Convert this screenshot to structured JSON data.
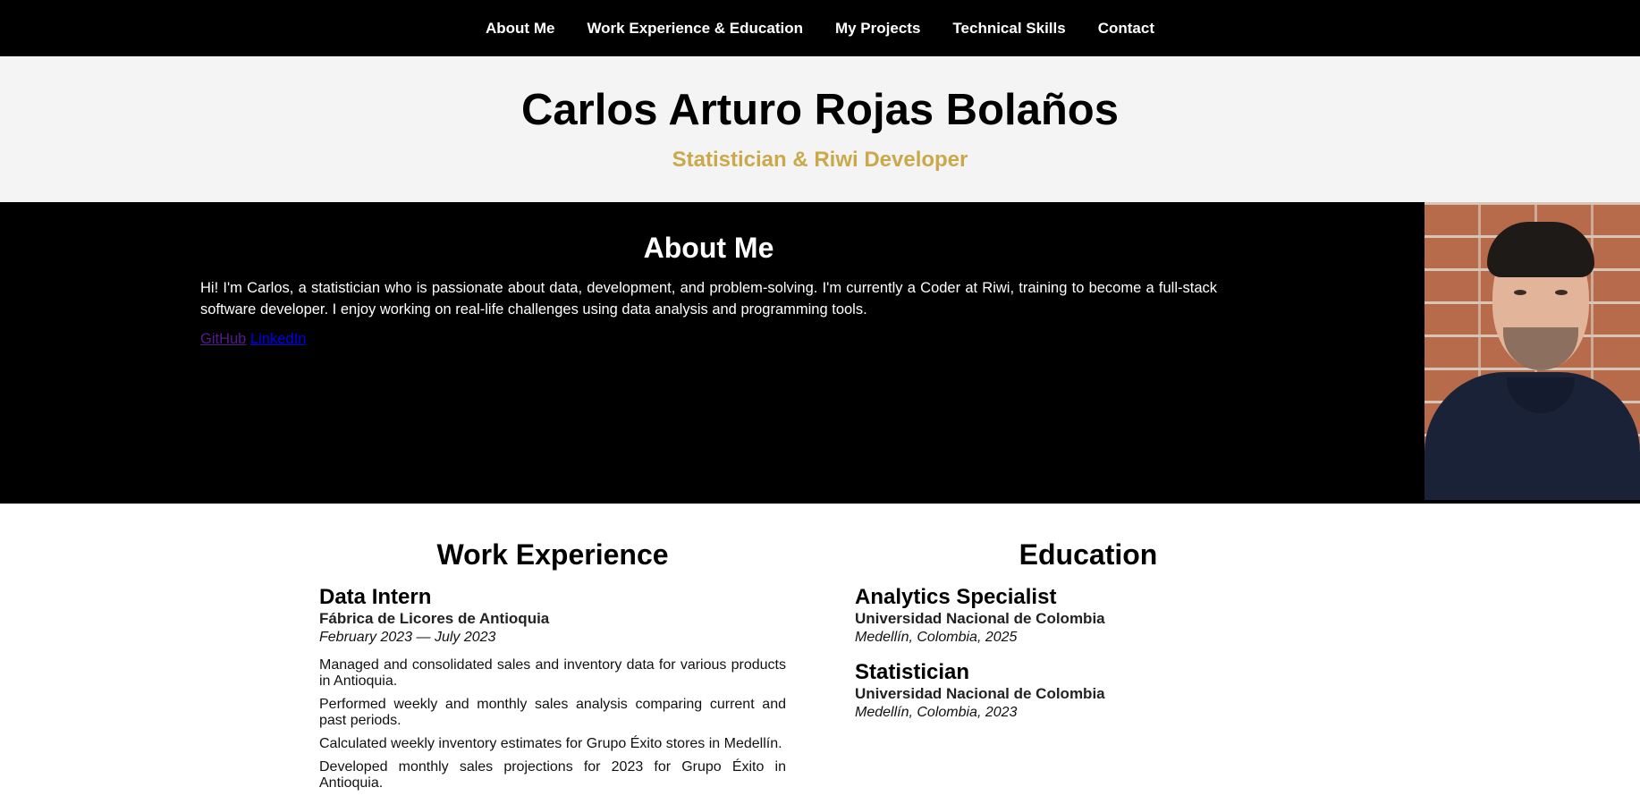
{
  "nav": {
    "items": [
      {
        "label": "About Me"
      },
      {
        "label": "Work Experience & Education"
      },
      {
        "label": "My Projects"
      },
      {
        "label": "Technical Skills"
      },
      {
        "label": "Contact"
      }
    ]
  },
  "hero": {
    "name": "Carlos Arturo Rojas Bolaños",
    "tagline": "Statistician & Riwi Developer",
    "tagline_color": "#c9a94a"
  },
  "about": {
    "heading": "About Me",
    "text": "Hi! I'm Carlos, a statistician who is passionate about data, development, and problem-solving. I'm currently a Coder at Riwi, training to become a full-stack software developer. I enjoy working on real-life challenges using data analysis and programming tools.",
    "links": [
      {
        "label": "GitHub"
      },
      {
        "label": "LinkedIn"
      }
    ]
  },
  "work": {
    "heading": "Work Experience",
    "jobs": [
      {
        "title": "Data Intern",
        "company": "Fábrica de Licores de Antioquia",
        "dates": "February 2023 — July 2023",
        "duties": [
          "Managed and consolidated sales and inventory data for various products in Antioquia.",
          "Performed weekly and monthly sales analysis comparing current and past periods.",
          "Calculated weekly inventory estimates for Grupo Éxito stores in Medellín.",
          "Developed monthly sales projections for 2023 for Grupo Éxito in Antioquia."
        ]
      }
    ]
  },
  "education": {
    "heading": "Education",
    "degrees": [
      {
        "title": "Analytics Specialist",
        "school": "Universidad Nacional de Colombia",
        "place": "Medellín, Colombia, 2025"
      },
      {
        "title": "Statistician",
        "school": "Universidad Nacional de Colombia",
        "place": "Medellín, Colombia, 2023"
      }
    ]
  }
}
